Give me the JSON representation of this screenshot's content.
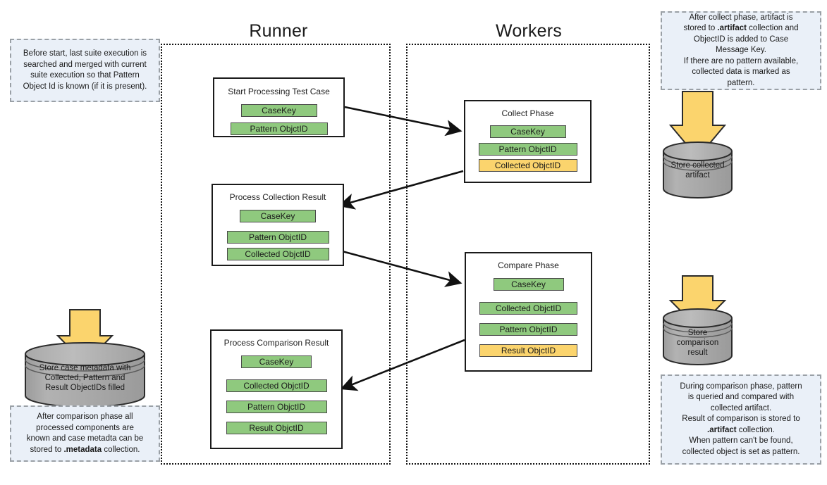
{
  "lanes": [
    {
      "title": "Runner"
    },
    {
      "title": "Workers"
    }
  ],
  "boxes": {
    "start_processing": {
      "title": "Start Processing Test Case",
      "chips": [
        {
          "label": "CaseKey",
          "color": "green"
        },
        {
          "label": "Pattern ObjctID",
          "color": "green"
        }
      ]
    },
    "collect_phase": {
      "title": "Collect Phase",
      "chips": [
        {
          "label": "CaseKey",
          "color": "green"
        },
        {
          "label": "Pattern ObjctID",
          "color": "green"
        },
        {
          "label": "Collected ObjctID",
          "color": "yellow"
        }
      ]
    },
    "process_collection_result": {
      "title": "Process Collection Result",
      "chips": [
        {
          "label": "CaseKey",
          "color": "green"
        },
        {
          "label": "Pattern ObjctID",
          "color": "green"
        },
        {
          "label": "Collected ObjctID",
          "color": "green"
        }
      ]
    },
    "compare_phase": {
      "title": "Compare Phase",
      "chips": [
        {
          "label": "CaseKey",
          "color": "green"
        },
        {
          "label": "Collected ObjctID",
          "color": "green"
        },
        {
          "label": "Pattern ObjctID",
          "color": "green"
        },
        {
          "label": "Result ObjctID",
          "color": "yellow"
        }
      ]
    },
    "process_comparison_result": {
      "title": "Process Comparison Result",
      "chips": [
        {
          "label": "CaseKey",
          "color": "green"
        },
        {
          "label": "Collected ObjctID",
          "color": "green"
        },
        {
          "label": "Pattern ObjctID",
          "color": "green"
        },
        {
          "label": "Result ObjctID",
          "color": "green"
        }
      ]
    }
  },
  "datastores": {
    "collected_artifact": {
      "label": "Store collected\nartifact"
    },
    "case_metadata": {
      "label": "Store case metadata with\nCollected, Pattern and\nResult ObjectIDs filled"
    },
    "comparison_result": {
      "label": "Store\ncomparison\nresult"
    }
  },
  "notes": {
    "top_left": {
      "lines": [
        "Before start, last suite execution is",
        "searched and merged with current",
        "suite execution so that Pattern",
        "Object Id is known (if it is present)."
      ]
    },
    "top_right": {
      "segments": [
        {
          "t": "After collect phase, artifact is",
          "bold": false
        },
        {
          "t": "\n",
          "bold": false
        },
        {
          "t": "stored to ",
          "bold": false
        },
        {
          "t": ".artifact",
          "bold": true
        },
        {
          "t": " collection and",
          "bold": false
        },
        {
          "t": "\n",
          "bold": false
        },
        {
          "t": "ObjectID is added to Case",
          "bold": false
        },
        {
          "t": "\n",
          "bold": false
        },
        {
          "t": "Message Key.",
          "bold": false
        },
        {
          "t": "\n",
          "bold": false
        },
        {
          "t": "If there are no pattern available,",
          "bold": false
        },
        {
          "t": "\n",
          "bold": false
        },
        {
          "t": "collected data is marked as",
          "bold": false
        },
        {
          "t": "\n",
          "bold": false
        },
        {
          "t": "pattern.",
          "bold": false
        }
      ]
    },
    "bottom_left": {
      "segments": [
        {
          "t": "After comparison phase all",
          "bold": false
        },
        {
          "t": "\n",
          "bold": false
        },
        {
          "t": "processed components are",
          "bold": false
        },
        {
          "t": "\n",
          "bold": false
        },
        {
          "t": "known and case metadta can be",
          "bold": false
        },
        {
          "t": "\n",
          "bold": false
        },
        {
          "t": "stored to ",
          "bold": false
        },
        {
          "t": ".metadata",
          "bold": true
        },
        {
          "t": " collection.",
          "bold": false
        }
      ]
    },
    "bottom_right": {
      "segments": [
        {
          "t": "During comparison phase, pattern",
          "bold": false
        },
        {
          "t": "\n",
          "bold": false
        },
        {
          "t": "is queried and compared with",
          "bold": false
        },
        {
          "t": "\n",
          "bold": false
        },
        {
          "t": "collected artifact.",
          "bold": false
        },
        {
          "t": "\n",
          "bold": false
        },
        {
          "t": "Result of comparison is stored to",
          "bold": false
        },
        {
          "t": "\n",
          "bold": false
        },
        {
          "t": ".artifact",
          "bold": true
        },
        {
          "t": " collection.",
          "bold": false
        },
        {
          "t": "\n",
          "bold": false
        },
        {
          "t": "When pattern can't be found,",
          "bold": false
        },
        {
          "t": "\n",
          "bold": false
        },
        {
          "t": "collected object is set as pattern.",
          "bold": false
        }
      ]
    }
  },
  "colors": {
    "chip_green": "#8FC97E",
    "chip_yellow": "#FBD46D",
    "note_bg": "#eaf0f8",
    "note_border": "#9aa0a6",
    "cylinder_fill": "#A6A6A6",
    "arrow_yellow": "#FBD46D",
    "stroke": "#1a1a1a"
  },
  "flows": [
    {
      "from": "start_processing",
      "to": "collect_phase",
      "direction": "right"
    },
    {
      "from": "collect_phase",
      "to": "process_collection_result",
      "direction": "left"
    },
    {
      "from": "process_collection_result",
      "to": "compare_phase",
      "direction": "right"
    },
    {
      "from": "compare_phase",
      "to": "process_comparison_result",
      "direction": "left"
    }
  ]
}
